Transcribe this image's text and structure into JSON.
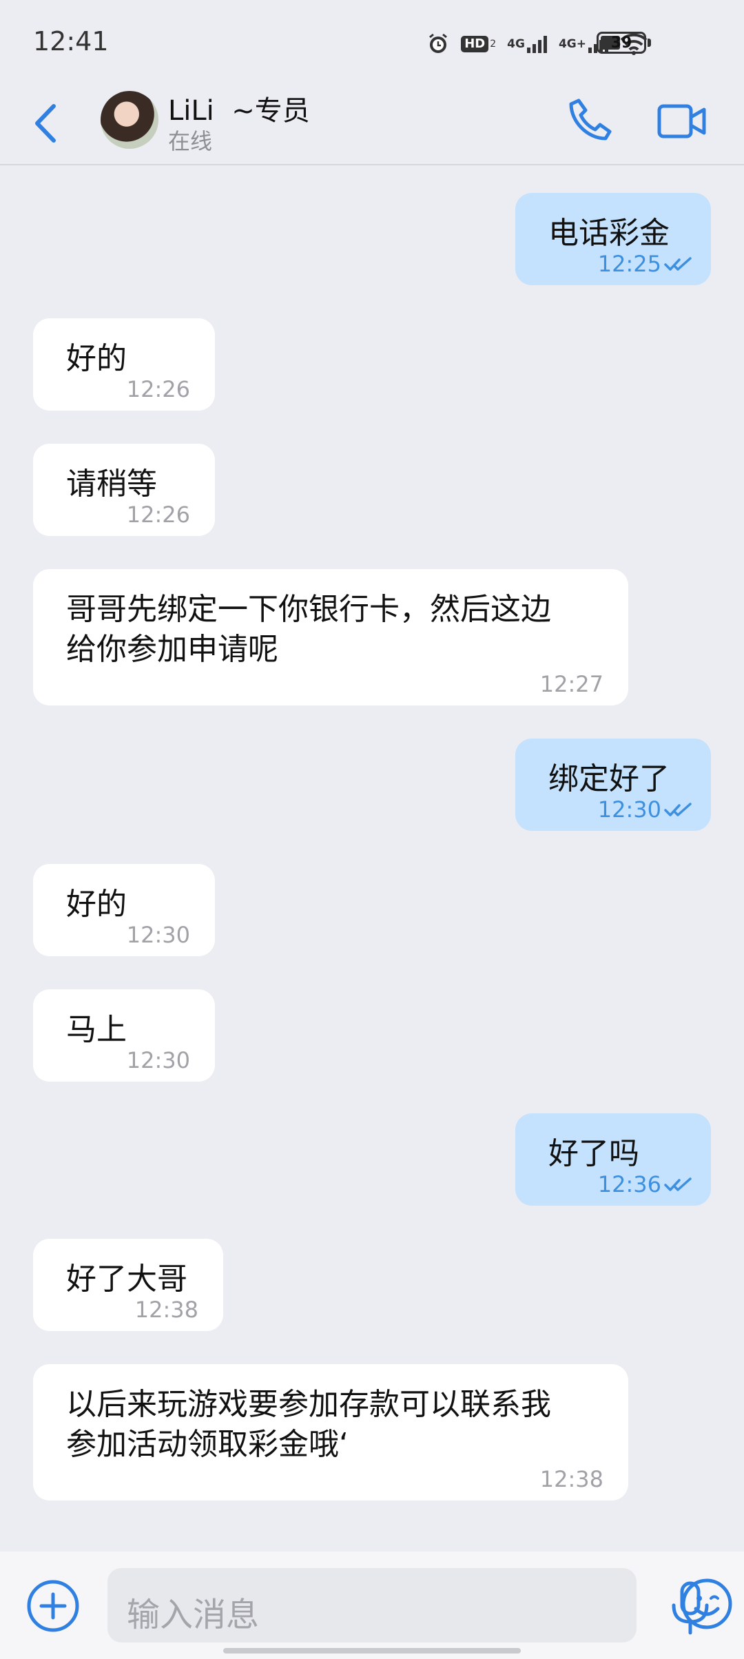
{
  "status_bar": {
    "time": "12:41",
    "hd_label": "HD",
    "hd_sub": "2",
    "net1": "4G",
    "net2": "4G+",
    "battery": "39"
  },
  "header": {
    "contact_name": "LiLi  ~专员",
    "contact_status": "在线"
  },
  "messages": [
    {
      "direction": "out",
      "lines": [
        "电话彩金"
      ],
      "time": "12:25"
    },
    {
      "direction": "in",
      "lines": [
        "好的"
      ],
      "time": "12:26"
    },
    {
      "direction": "in",
      "lines": [
        "请稍等"
      ],
      "time": "12:26"
    },
    {
      "direction": "in",
      "lines": [
        "哥哥先绑定一下你银行卡，然后这边",
        "给你参加申请呢"
      ],
      "time": "12:27"
    },
    {
      "direction": "out",
      "lines": [
        "绑定好了"
      ],
      "time": "12:30"
    },
    {
      "direction": "in",
      "lines": [
        "好的"
      ],
      "time": "12:30"
    },
    {
      "direction": "in",
      "lines": [
        "马上"
      ],
      "time": "12:30"
    },
    {
      "direction": "out",
      "lines": [
        "好了吗"
      ],
      "time": "12:36"
    },
    {
      "direction": "in",
      "lines": [
        "好了大哥"
      ],
      "time": "12:38"
    },
    {
      "direction": "in",
      "lines": [
        "以后来玩游戏要参加存款可以联系我",
        "参加活动领取彩金哦‘"
      ],
      "time": "12:38"
    }
  ],
  "input": {
    "placeholder": "输入消息"
  },
  "colors": {
    "accent": "#2F80E0",
    "outgoing_bubble": "#C4E2FD",
    "incoming_bubble": "#FFFFFF",
    "background": "#ECEDF2"
  }
}
